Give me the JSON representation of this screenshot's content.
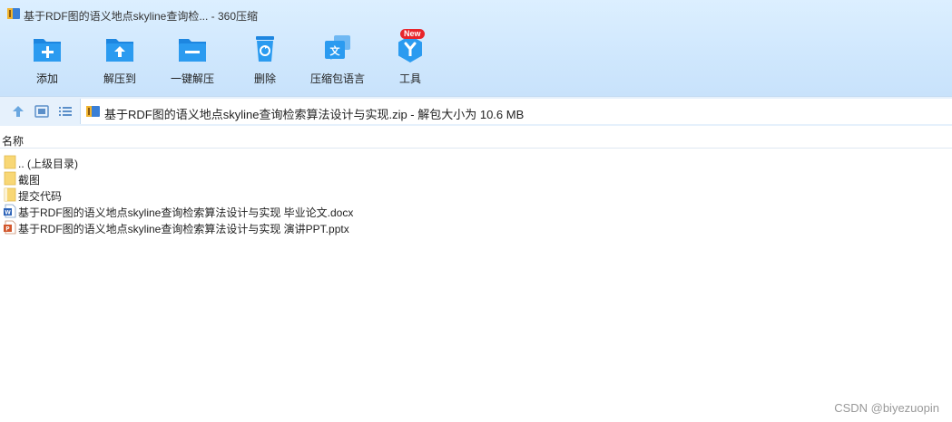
{
  "window": {
    "title": "基于RDF图的语义地点skyline查询检... - 360压缩"
  },
  "toolbar": {
    "items": [
      {
        "label": "添加",
        "icon": "folder-add-icon"
      },
      {
        "label": "解压到",
        "icon": "folder-extract-icon"
      },
      {
        "label": "一键解压",
        "icon": "folder-one-click-extract-icon"
      },
      {
        "label": "删除",
        "icon": "recycle-bin-icon"
      },
      {
        "label": "压缩包语言",
        "icon": "language-icon"
      },
      {
        "label": "工具",
        "icon": "tools-icon",
        "badge": "New"
      }
    ]
  },
  "address": {
    "path": "基于RDF图的语义地点skyline查询检索算法设计与实现.zip - 解包大小为 10.6 MB"
  },
  "columns": {
    "name": "名称"
  },
  "files": [
    {
      "name": ".. (上级目录)",
      "type": "folder"
    },
    {
      "name": "截图",
      "type": "folder"
    },
    {
      "name": "提交代码",
      "type": "folder-file"
    },
    {
      "name": "基于RDF图的语义地点skyline查询检索算法设计与实现 毕业论文.docx",
      "type": "docx"
    },
    {
      "name": "基于RDF图的语义地点skyline查询检索算法设计与实现 演讲PPT.pptx",
      "type": "pptx"
    }
  ],
  "watermark": "CSDN @biyezuopin",
  "colors": {
    "accent": "#2b8fe6",
    "badge": "#e8252b",
    "folder": "#f8d775"
  }
}
